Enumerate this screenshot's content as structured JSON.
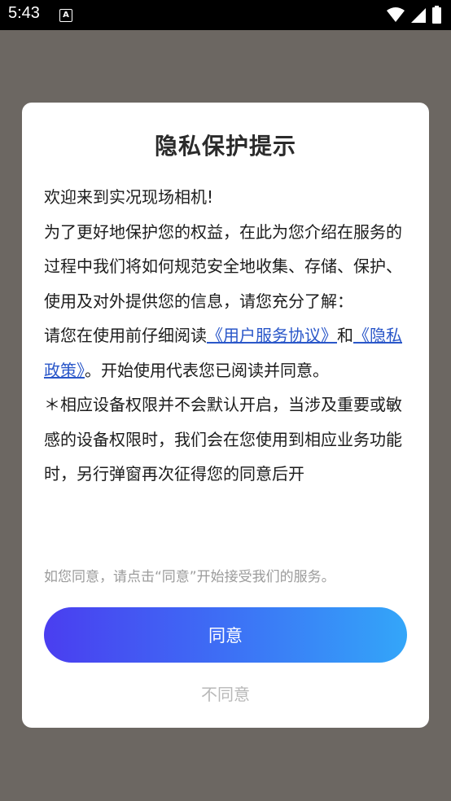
{
  "status_bar": {
    "time": "5:43",
    "notification_icon": "A",
    "icons": [
      "wifi-icon",
      "signal-icon",
      "battery-icon"
    ]
  },
  "dialog": {
    "title": "隐私保护提示",
    "welcome": "欢迎来到实况现场相机!",
    "para1": "为了更好地保护您的权益，在此为您介绍在服务的过程中我们将如何规范安全地收集、存储、保护、使用及对外提供您的信息，请您充分了解：",
    "para2_prefix": "请您在使用前仔细阅读",
    "user_agreement_link": "《用户服务协议》",
    "para2_and": "和",
    "privacy_policy_link": "《隐私政策》",
    "para2_suffix": "。开始使用代表您已阅读并同意。",
    "para3": "＊相应设备权限并不会默认开启，当涉及重要或敏感的设备权限时，我们会在您使用到相应业务功能时，另行弹窗再次征得您的同意后开",
    "hint": "如您同意，请点击“同意”开始接受我们的服务。",
    "agree_label": "同意",
    "disagree_label": "不同意"
  },
  "colors": {
    "overlay": "#6c6762",
    "link": "#2a57c9",
    "button_gradient_start": "#4a3ef0",
    "button_gradient_end": "#33a6f9"
  }
}
